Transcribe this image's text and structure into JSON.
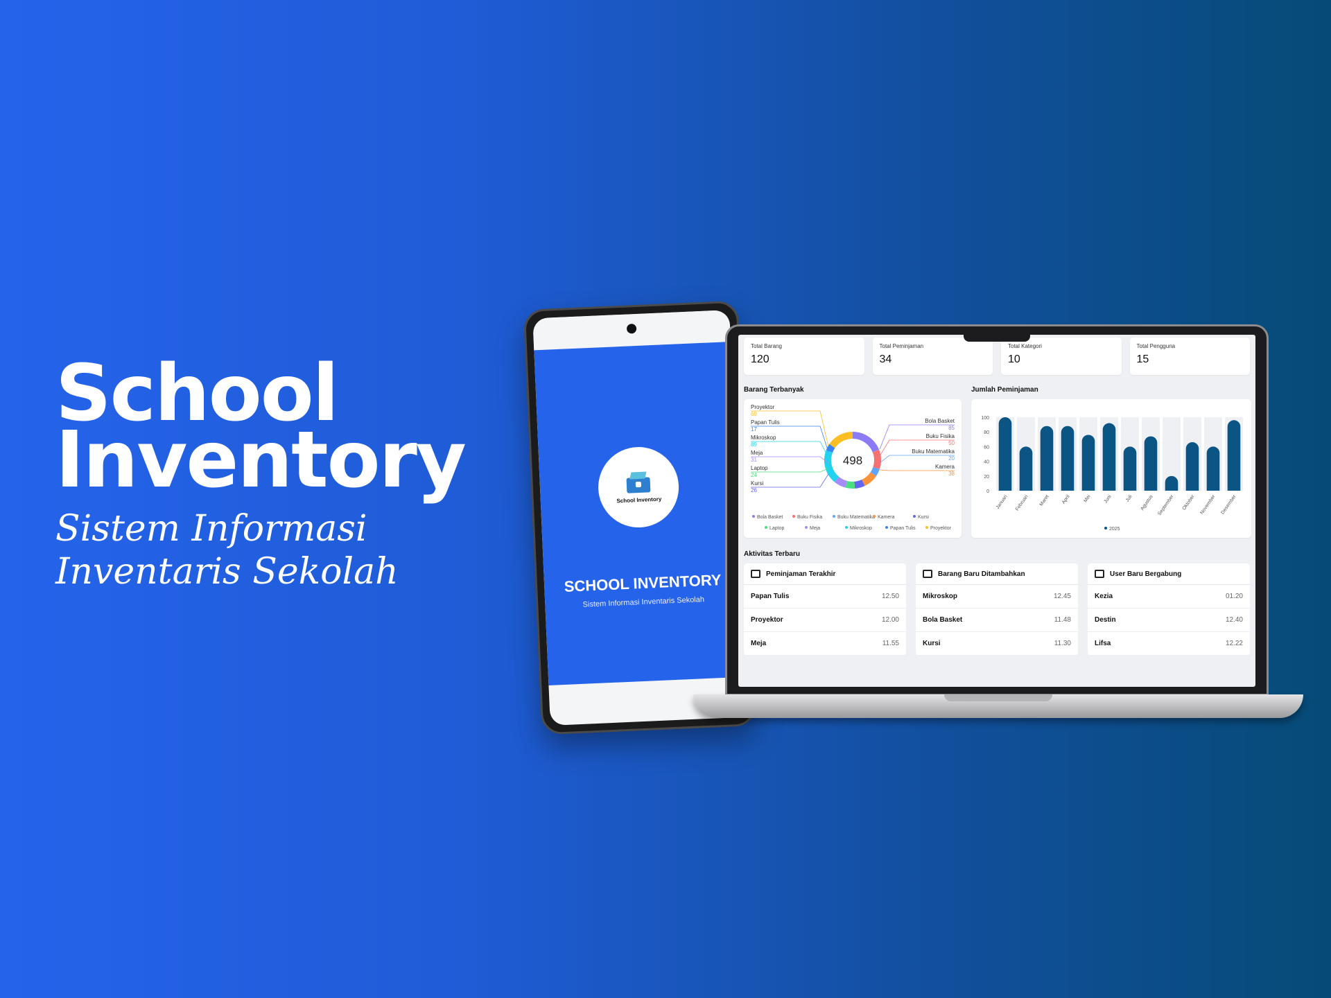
{
  "hero": {
    "title": "School\nInventory",
    "subtitle": "Sistem Informasi Inventaris Sekolah"
  },
  "phone": {
    "logo_text": "School Inventory",
    "title": "SCHOOL INVENTORY",
    "subtitle": "Sistem Informasi Inventaris Sekolah"
  },
  "dashboard": {
    "stats": [
      {
        "label": "Total Barang",
        "value": "120"
      },
      {
        "label": "Total Peminjaman",
        "value": "34"
      },
      {
        "label": "Total Kategori",
        "value": "10"
      },
      {
        "label": "Total Pengguna",
        "value": "15"
      }
    ],
    "donut_title": "Barang Terbanyak",
    "bar_title": "Jumlah Peminjaman",
    "activity_title": "Aktivitas Terbaru",
    "activities": [
      {
        "title": "Peminjaman Terakhir",
        "items": [
          {
            "name": "Papan Tulis",
            "time": "12.50"
          },
          {
            "name": "Proyektor",
            "time": "12.00"
          },
          {
            "name": "Meja",
            "time": "11.55"
          }
        ]
      },
      {
        "title": "Barang Baru Ditambahkan",
        "items": [
          {
            "name": "Mikroskop",
            "time": "12.45"
          },
          {
            "name": "Bola Basket",
            "time": "11.48"
          },
          {
            "name": "Kursi",
            "time": "11.30"
          }
        ]
      },
      {
        "title": "User Baru Bergabung",
        "items": [
          {
            "name": "Kezia",
            "time": "01.20"
          },
          {
            "name": "Destin",
            "time": "12.40"
          },
          {
            "name": "Lifsa",
            "time": "12.22"
          }
        ]
      }
    ]
  },
  "chart_data": [
    {
      "type": "pie",
      "title": "Barang Terbanyak",
      "total": 498,
      "slices": [
        {
          "label": "Bola Basket",
          "value": 85,
          "color": "#8b7cf6"
        },
        {
          "label": "Buku Fisika",
          "value": 50,
          "color": "#f87171"
        },
        {
          "label": "Buku Matematika",
          "value": 20,
          "color": "#60a5fa"
        },
        {
          "label": "Kamera",
          "value": 38,
          "color": "#fb923c"
        },
        {
          "label": "Kursi",
          "value": 26,
          "color": "#6366f1"
        },
        {
          "label": "Laptop",
          "value": 24,
          "color": "#4ade80"
        },
        {
          "label": "Meja",
          "value": 31,
          "color": "#a78bfa"
        },
        {
          "label": "Mikroskop",
          "value": 89,
          "color": "#22d3ee"
        },
        {
          "label": "Papan Tulis",
          "value": 17,
          "color": "#3b82f6"
        },
        {
          "label": "Proyektor",
          "value": 69,
          "color": "#fbbf24"
        }
      ],
      "legend": [
        "Bola Basket",
        "Buku Fisika",
        "Buku Matematika",
        "Kamera",
        "Kursi",
        "Laptop",
        "Meja",
        "Mikroskop",
        "Papan Tulis",
        "Proyektor"
      ]
    },
    {
      "type": "bar",
      "title": "Jumlah Peminjaman",
      "categories": [
        "Januari",
        "Februari",
        "Maret",
        "April",
        "Mei",
        "Juni",
        "Juli",
        "Agustus",
        "September",
        "Oktober",
        "November",
        "Desember"
      ],
      "series": [
        {
          "name": "2025",
          "values": [
            100,
            60,
            88,
            88,
            76,
            92,
            60,
            74,
            20,
            66,
            60,
            96
          ]
        }
      ],
      "ylim": [
        0,
        100
      ],
      "yticks": [
        0,
        20,
        40,
        60,
        80,
        100
      ],
      "bar_color": "#0b5585",
      "legend": "bottom"
    }
  ]
}
